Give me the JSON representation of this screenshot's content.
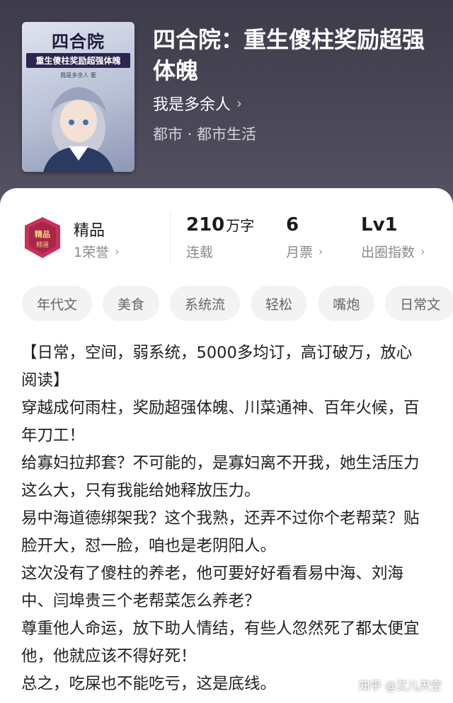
{
  "book": {
    "title": "四合院：重生傻柱奖励超强体魄",
    "author": "我是多余人",
    "genre": "都市 · 都市生活",
    "cover": {
      "title": "四合院",
      "subtitle": "重生傻柱奖励超强体魄",
      "author": "我是多余人 著"
    }
  },
  "stats": {
    "badge_label": "精品",
    "honor": "1荣誉",
    "word_count": "210",
    "word_unit": "万字",
    "status": "连载",
    "monthly_votes": "6",
    "monthly_votes_label": "月票",
    "level": "Lv1",
    "level_label": "出圈指数"
  },
  "tags": [
    "年代文",
    "美食",
    "系统流",
    "轻松",
    "嘴炮",
    "日常文"
  ],
  "description": [
    "【日常，空间，弱系统，5000多均订，高订破万，放心阅读】",
    "穿越成何雨柱，奖励超强体魄、川菜通神、百年火候，百年刀工！",
    "给寡妇拉邦套？不可能的，是寡妇离不开我，她生活压力这么大，只有我能给她释放压力。",
    "易中海道德绑架我？这个我熟，还弄不过你个老帮菜？贴脸开大，怼一脸，咱也是老阴阳人。",
    "这次没有了傻柱的养老，他可要好好看看易中海、刘海中、闫埠贵三个老帮菜怎么养老？",
    "尊重他人命运，放下助人情结，有些人忽然死了都太便宜他，他就应该不得好死！",
    "总之，吃屎也不能吃亏，这是底线。"
  ],
  "watermark": "知乎 @艾儿天空",
  "colors": {
    "header_bg": "#46434f",
    "tag_bg": "#f3f3f5",
    "badge": "#c8315a"
  }
}
